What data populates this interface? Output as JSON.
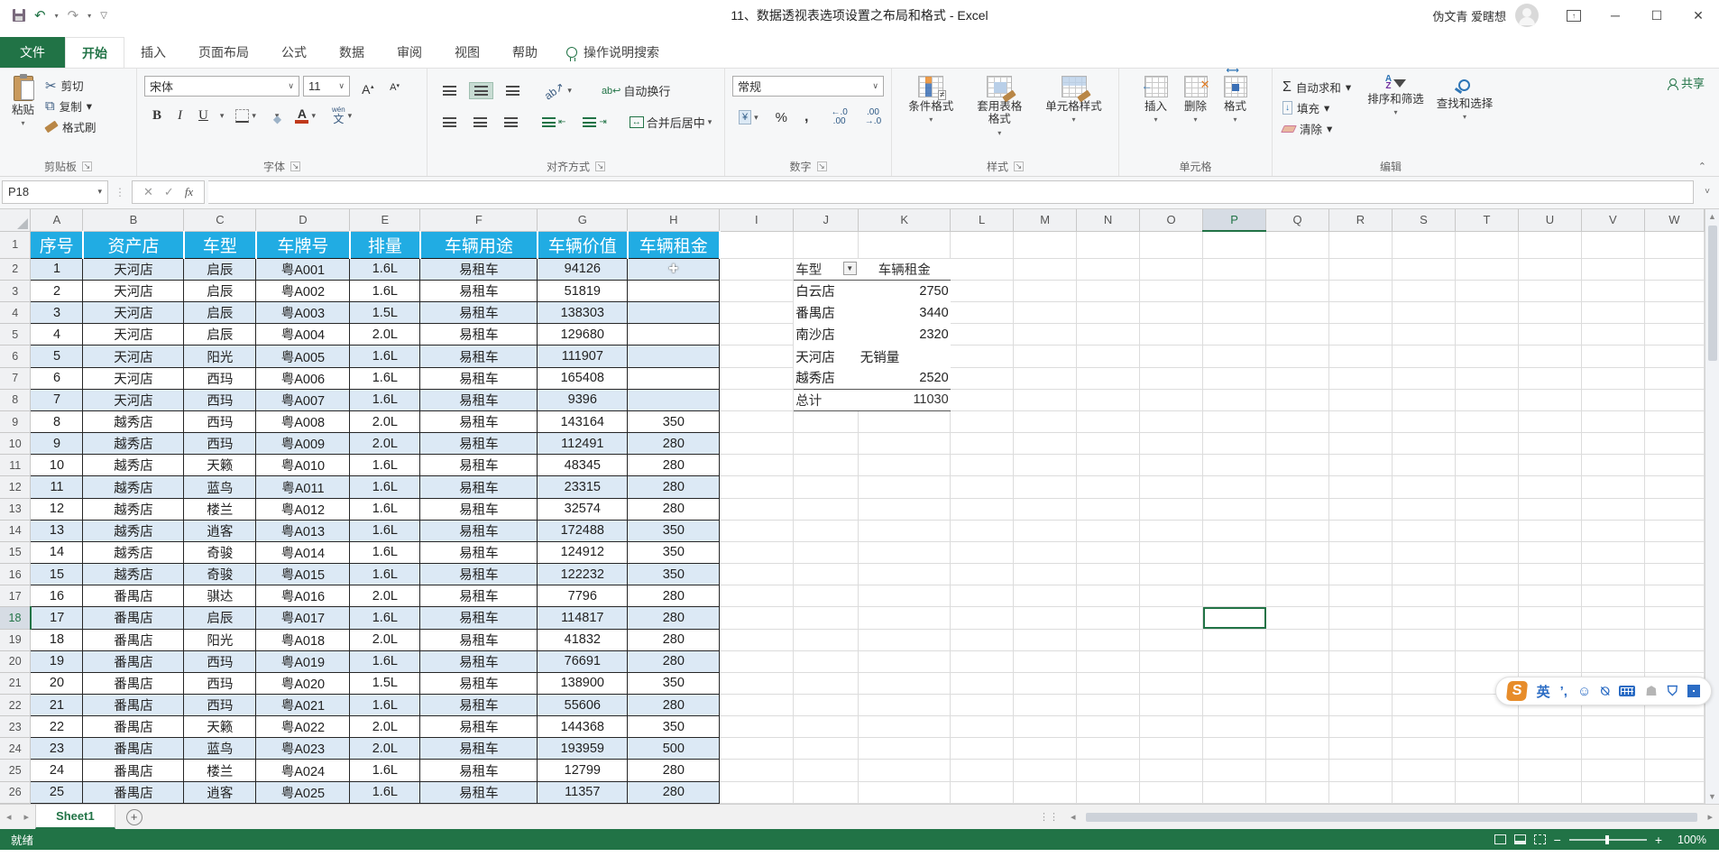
{
  "title_bar": {
    "title": "11、数据透视表选项设置之布局和格式 - Excel",
    "user_name": "伪文青 爱瞎想"
  },
  "ribbon": {
    "tabs": [
      "文件",
      "开始",
      "插入",
      "页面布局",
      "公式",
      "数据",
      "审阅",
      "视图",
      "帮助"
    ],
    "active_tab": "开始",
    "search_label": "操作说明搜索",
    "share_label": "共享",
    "clipboard": {
      "label": "剪贴板",
      "paste": "粘贴",
      "cut": "剪切",
      "copy": "复制",
      "format_painter": "格式刷"
    },
    "font": {
      "label": "字体",
      "font_name": "宋体",
      "font_size": "11"
    },
    "alignment": {
      "label": "对齐方式",
      "wrap_text": "自动换行",
      "merge_center": "合并后居中"
    },
    "number": {
      "label": "数字",
      "format": "常规"
    },
    "styles": {
      "label": "样式",
      "conditional": "条件格式",
      "format_table": "套用表格格式",
      "cell_styles": "单元格样式"
    },
    "cells": {
      "label": "单元格",
      "insert": "插入",
      "delete": "删除",
      "format": "格式"
    },
    "editing": {
      "label": "编辑",
      "autosum": "自动求和",
      "fill": "填充",
      "clear": "清除",
      "sort_filter": "排序和筛选",
      "find_select": "查找和选择"
    }
  },
  "formula_bar": {
    "name_box": "P18",
    "formula": ""
  },
  "sheet": {
    "columns": [
      "A",
      "B",
      "C",
      "D",
      "E",
      "F",
      "G",
      "H",
      "I",
      "J",
      "K",
      "L",
      "M",
      "N",
      "O",
      "P",
      "Q",
      "R",
      "S",
      "T",
      "U",
      "V",
      "W"
    ],
    "selected_column": "P",
    "selected_row": 18,
    "selected_cell": "P18",
    "visible_rows": 26,
    "table": {
      "headers": [
        "序号",
        "资产店",
        "车型",
        "车牌号",
        "排量",
        "车辆用途",
        "车辆价值",
        "车辆租金"
      ],
      "rows": [
        [
          "1",
          "天河店",
          "启辰",
          "粤A001",
          "1.6L",
          "易租车",
          "94126",
          ""
        ],
        [
          "2",
          "天河店",
          "启辰",
          "粤A002",
          "1.6L",
          "易租车",
          "51819",
          ""
        ],
        [
          "3",
          "天河店",
          "启辰",
          "粤A003",
          "1.5L",
          "易租车",
          "138303",
          ""
        ],
        [
          "4",
          "天河店",
          "启辰",
          "粤A004",
          "2.0L",
          "易租车",
          "129680",
          ""
        ],
        [
          "5",
          "天河店",
          "阳光",
          "粤A005",
          "1.6L",
          "易租车",
          "111907",
          ""
        ],
        [
          "6",
          "天河店",
          "西玛",
          "粤A006",
          "1.6L",
          "易租车",
          "165408",
          ""
        ],
        [
          "7",
          "天河店",
          "西玛",
          "粤A007",
          "1.6L",
          "易租车",
          "9396",
          ""
        ],
        [
          "8",
          "越秀店",
          "西玛",
          "粤A008",
          "2.0L",
          "易租车",
          "143164",
          "350"
        ],
        [
          "9",
          "越秀店",
          "西玛",
          "粤A009",
          "2.0L",
          "易租车",
          "112491",
          "280"
        ],
        [
          "10",
          "越秀店",
          "天籁",
          "粤A010",
          "1.6L",
          "易租车",
          "48345",
          "280"
        ],
        [
          "11",
          "越秀店",
          "蓝鸟",
          "粤A011",
          "1.6L",
          "易租车",
          "23315",
          "280"
        ],
        [
          "12",
          "越秀店",
          "楼兰",
          "粤A012",
          "1.6L",
          "易租车",
          "32574",
          "280"
        ],
        [
          "13",
          "越秀店",
          "逍客",
          "粤A013",
          "1.6L",
          "易租车",
          "172488",
          "350"
        ],
        [
          "14",
          "越秀店",
          "奇骏",
          "粤A014",
          "1.6L",
          "易租车",
          "124912",
          "350"
        ],
        [
          "15",
          "越秀店",
          "奇骏",
          "粤A015",
          "1.6L",
          "易租车",
          "122232",
          "350"
        ],
        [
          "16",
          "番禺店",
          "骐达",
          "粤A016",
          "2.0L",
          "易租车",
          "7796",
          "280"
        ],
        [
          "17",
          "番禺店",
          "启辰",
          "粤A017",
          "1.6L",
          "易租车",
          "114817",
          "280"
        ],
        [
          "18",
          "番禺店",
          "阳光",
          "粤A018",
          "2.0L",
          "易租车",
          "41832",
          "280"
        ],
        [
          "19",
          "番禺店",
          "西玛",
          "粤A019",
          "1.6L",
          "易租车",
          "76691",
          "280"
        ],
        [
          "20",
          "番禺店",
          "西玛",
          "粤A020",
          "1.5L",
          "易租车",
          "138900",
          "350"
        ],
        [
          "21",
          "番禺店",
          "西玛",
          "粤A021",
          "1.6L",
          "易租车",
          "55606",
          "280"
        ],
        [
          "22",
          "番禺店",
          "天籁",
          "粤A022",
          "2.0L",
          "易租车",
          "144368",
          "350"
        ],
        [
          "23",
          "番禺店",
          "蓝鸟",
          "粤A023",
          "2.0L",
          "易租车",
          "193959",
          "500"
        ],
        [
          "24",
          "番禺店",
          "楼兰",
          "粤A024",
          "1.6L",
          "易租车",
          "12799",
          "280"
        ],
        [
          "25",
          "番禺店",
          "逍客",
          "粤A025",
          "1.6L",
          "易租车",
          "11357",
          "280"
        ]
      ]
    },
    "pivot": {
      "header": [
        "车型",
        "车辆租金"
      ],
      "rows": [
        [
          "白云店",
          "2750"
        ],
        [
          "番禺店",
          "3440"
        ],
        [
          "南沙店",
          "2320"
        ],
        [
          "天河店",
          "无销量"
        ],
        [
          "越秀店",
          "2520"
        ]
      ],
      "total": [
        "总计",
        "11030"
      ]
    }
  },
  "sheet_bar": {
    "sheet_tabs": [
      "Sheet1"
    ]
  },
  "status_bar": {
    "ready": "就绪",
    "zoom_level": "100%"
  },
  "ime_toolbar": {
    "mode": "英"
  },
  "colors": {
    "excel_green": "#217346",
    "table_header_blue": "#21ace3",
    "banded_row_blue": "#dce9f5",
    "sogou_orange": "#e78c2a"
  }
}
